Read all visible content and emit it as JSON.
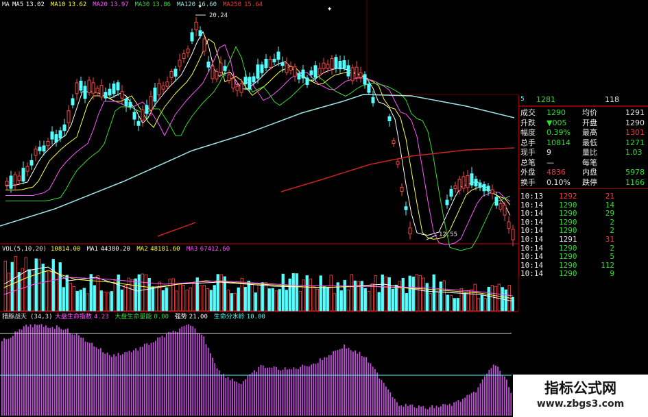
{
  "colors": {
    "up": "#ff4444",
    "down": "#54ffff",
    "text_green": "#33dd33",
    "text_red": "#ff3333",
    "text_white": "#e8e8e8",
    "yellow": "#ffff44",
    "magenta": "#ff55ff",
    "grid_red": "#8a0000"
  },
  "main_chart": {
    "indicator": "MA",
    "ma_legend": [
      {
        "label": "MA5",
        "value": "13.02",
        "color": "#ffffff"
      },
      {
        "label": "MA10",
        "value": "13.62",
        "color": "#ffff44"
      },
      {
        "label": "MA20",
        "value": "13.97",
        "color": "#ff55ff"
      },
      {
        "label": "MA30",
        "value": "13.86",
        "color": "#33dd33"
      },
      {
        "label": "MA120",
        "value": "16.60",
        "color": "#9fe4e4"
      },
      {
        "label": "MA250",
        "value": "15.64",
        "color": "#ff3333"
      }
    ],
    "high_label": "20.24",
    "low_label": "12.55"
  },
  "volume_chart": {
    "name": "VOL(5,10,20)",
    "items": [
      {
        "label": "",
        "value": "10814.00",
        "color": "#ffff44"
      },
      {
        "label": "MA1",
        "value": "44380.20",
        "color": "#ffffff"
      },
      {
        "label": "MA2",
        "value": "48181.60",
        "color": "#ffff44"
      },
      {
        "label": "MA3",
        "value": "67412.60",
        "color": "#ff55ff"
      }
    ]
  },
  "indicator_chart": {
    "name": "猎豚战天",
    "params": "(34,3)",
    "items": [
      {
        "label": "大盘生命指数",
        "value": "4.23",
        "color": "#ff55ff"
      },
      {
        "label": "大盘生命量能",
        "value": "0.00",
        "color": "#33dd33"
      },
      {
        "label": "强势",
        "value": "21.00",
        "color": "#ffffff"
      },
      {
        "label": "生命分水岭",
        "value": "10.00",
        "color": "#54ffff"
      }
    ]
  },
  "quote_panel": {
    "header_cut": {
      "left": "1281",
      "right": "118"
    },
    "rows": [
      {
        "l1": "成交",
        "v1": "1290",
        "l2": "均价",
        "v2": "1291"
      },
      {
        "l1": "升跌",
        "v1": "▼005",
        "l2": "开盘",
        "v2": "1290"
      },
      {
        "l1": "幅度",
        "v1": "0.39%",
        "l2": "最高",
        "v2": "1301"
      },
      {
        "l1": "总手",
        "v1": "10814",
        "l2": "最低",
        "v2": "1271"
      },
      {
        "l1": "现手",
        "v1": "9",
        "l2": "量比",
        "v2": "1.03"
      },
      {
        "l1": "总笔",
        "v1": "—",
        "l2": "每笔",
        "v2": ""
      },
      {
        "l1": "外盘",
        "v1": "4836",
        "l2": "内盘",
        "v2": "5978"
      },
      {
        "l1": "换手",
        "v1": "0.10%",
        "l2": "跌停",
        "v2": "1166"
      }
    ]
  },
  "ticks": [
    {
      "time": "10:13",
      "price": "1292",
      "vol": "21"
    },
    {
      "time": "10:14",
      "price": "1290",
      "vol": "14"
    },
    {
      "time": "10:14",
      "price": "1290",
      "vol": "29"
    },
    {
      "time": "10:14",
      "price": "1290",
      "vol": "2"
    },
    {
      "time": "10:14",
      "price": "1290",
      "vol": "2"
    },
    {
      "time": "10:14",
      "price": "1291",
      "vol": "31"
    },
    {
      "time": "10:14",
      "price": "1290",
      "vol": "2"
    },
    {
      "time": "10:14",
      "price": "1290",
      "vol": "5"
    },
    {
      "time": "10:14",
      "price": "1290",
      "vol": "112"
    },
    {
      "time": "10:14",
      "price": "1290",
      "vol": "9"
    }
  ],
  "watermark": {
    "title": "指标公式网",
    "url": "www.zbgs3.com"
  }
}
